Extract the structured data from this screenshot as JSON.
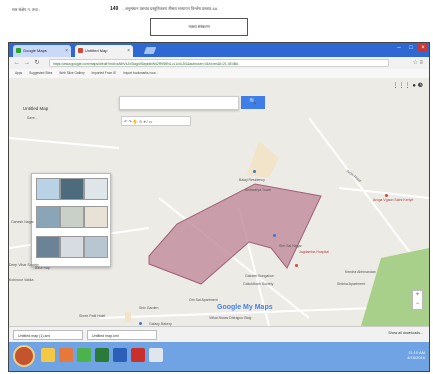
{
  "document": {
    "header_left": "सार संक्षेप न. तथा :",
    "page_number": "149",
    "header_title": "- अनुसंधान प्रस्ताव प्रस्तुतिकरण तीसरा सत्यापन विश्लेष प्रस्ताव 4A",
    "box_label": "नक्शा संस्करण"
  },
  "browser": {
    "tabs": [
      {
        "label": "Google Maps"
      },
      {
        "label": "Untitled Map"
      }
    ],
    "url": "https://www.google.com/maps/d/edit?mid=zAfbVxZxSlag4rSwpldbWs2RrBl9NLLv1c4L3f1&authuser=0&hl=en&ll=21.4E4BA",
    "bookmarks": [
      "Apps",
      "Suggested Sites",
      "Web Slice Gallery",
      "Imported From IE",
      "Import bookmarks now..."
    ]
  },
  "map": {
    "title": "Untitled Map",
    "subtitle": "Save...",
    "layer_caption": "Base map",
    "search_placeholder": "",
    "draw_tools": "↶ ↷  ✋  ⊙  ⌖  ∕  ▭",
    "account": "⋮⋮⋮  ● ❸",
    "logo": "Google My Maps",
    "labels": [
      {
        "text": "Balaji Residency",
        "color": "gray"
      },
      {
        "text": "Aishwarya Tower",
        "color": "gray"
      },
      {
        "text": "Shri Sai Nagar",
        "color": "gray"
      },
      {
        "text": "Ardhi Road",
        "color": "gray"
      },
      {
        "text": "Aroga Vgaon Saint Kenye",
        "color": "red"
      },
      {
        "text": "Gatubel Bungalow",
        "color": "gray"
      },
      {
        "text": "Gokuldham Society",
        "color": "gray"
      },
      {
        "text": "Kendra Abhinandan",
        "color": "gray"
      },
      {
        "text": "Shree Patil Hotel",
        "color": "gray"
      },
      {
        "text": "Galaxy Bakery",
        "color": "gray"
      },
      {
        "text": "Vithai Niwas Dhirajpur Bldg",
        "color": "gray"
      },
      {
        "text": "Deep Vihar Society",
        "color": "gray"
      },
      {
        "text": "Shibha Apartment",
        "color": "gray"
      },
      {
        "text": "Kohinoor Vatika",
        "color": "gray"
      },
      {
        "text": "Shiv Garden",
        "color": "gray"
      },
      {
        "text": "Ganesh Nagar",
        "color": "gray"
      },
      {
        "text": "Om Sai Apartment",
        "color": "gray"
      },
      {
        "text": "Jagdamba Hospital",
        "color": "red"
      }
    ]
  },
  "downloads": {
    "items": [
      "Untitled map (1).kml",
      "Untitled map.kml"
    ],
    "show_all": "Show all downloads..."
  },
  "taskbar": {
    "tray_time": "11:10 AM",
    "tray_date": "4/15/2016"
  },
  "colors": {
    "tabbar": "#2f67d3",
    "polygon": "#c1899a",
    "green_area": "#a9d08a",
    "map_bg": "#ecebe6"
  }
}
